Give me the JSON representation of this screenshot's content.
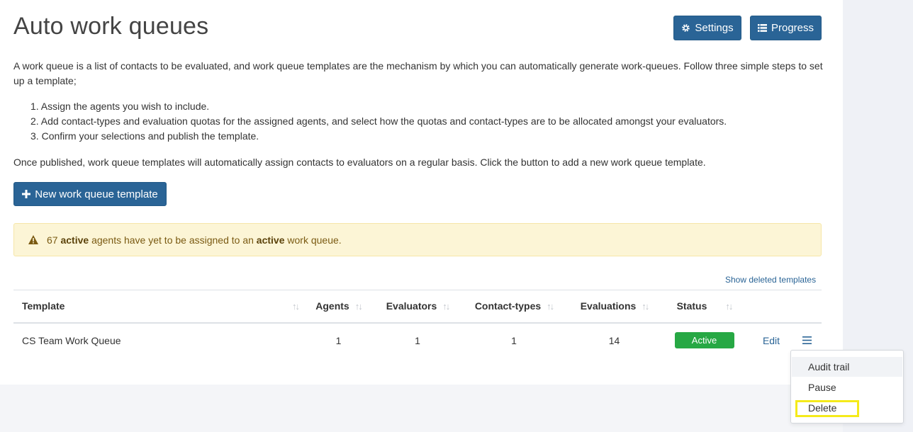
{
  "page": {
    "title": "Auto work queues",
    "settings_label": "Settings",
    "progress_label": "Progress",
    "intro": "A work queue is a list of contacts to be evaluated, and work queue templates are the mechanism by which you can automatically generate work-queues. Follow three simple steps to set up a template;",
    "steps": [
      "Assign the agents you wish to include.",
      "Add contact-types and evaluation quotas for the assigned agents, and select how the quotas and contact-types are to be allocated amongst your evaluators.",
      "Confirm your selections and publish the template."
    ],
    "outro": "Once published, work queue templates will automatically assign contacts to evaluators on a regular basis. Click the button to add a new work queue template.",
    "new_button_label": "New work queue template"
  },
  "alert": {
    "count": "67",
    "word_active": "active",
    "mid": "agents have yet to be assigned to an",
    "word_active2": "active",
    "end": "work queue."
  },
  "table": {
    "show_deleted": "Show deleted templates",
    "headers": [
      "Template",
      "Agents",
      "Evaluators",
      "Contact-types",
      "Evaluations",
      "Status"
    ],
    "rows": [
      {
        "template": "CS Team Work Queue",
        "agents": "1",
        "evaluators": "1",
        "contact_types": "1",
        "evaluations": "14",
        "status": "Active",
        "edit": "Edit"
      }
    ]
  },
  "menu": {
    "items": [
      "Audit trail",
      "Pause",
      "Delete"
    ]
  },
  "colors": {
    "primary": "#2a6496",
    "active_badge": "#27a844",
    "alert_bg": "#fcf5d6",
    "highlight": "#f5ea1a"
  },
  "icons": {
    "settings": "gear-icon",
    "progress": "list-icon",
    "add": "plus-icon",
    "alert": "warning-icon",
    "sort": "sort-icon",
    "row_menu": "hamburger-icon"
  }
}
